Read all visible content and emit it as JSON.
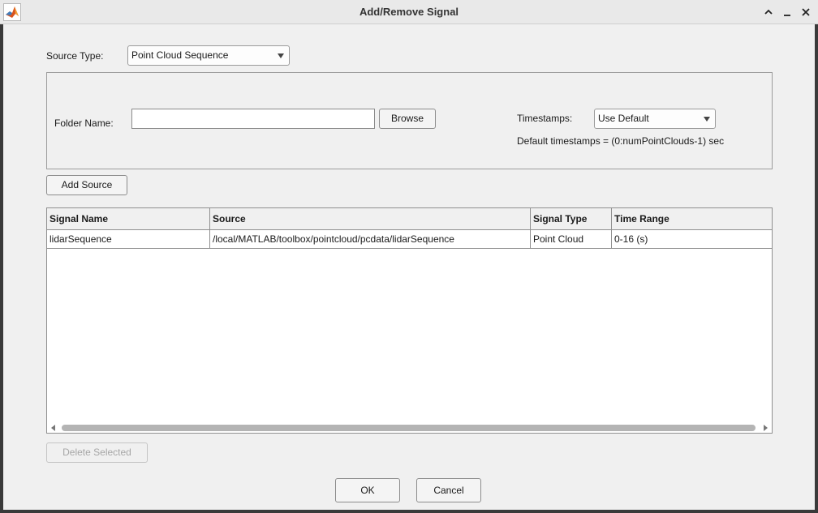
{
  "window": {
    "title": "Add/Remove Signal"
  },
  "source_type": {
    "label": "Source Type:",
    "selected": "Point Cloud Sequence"
  },
  "folder": {
    "label": "Folder Name:",
    "value": "",
    "browse_label": "Browse"
  },
  "timestamps": {
    "label": "Timestamps:",
    "selected": "Use Default",
    "note": "Default timestamps = (0:numPointClouds-1) sec"
  },
  "add_source_label": "Add Source",
  "table": {
    "columns": [
      "Signal Name",
      "Source",
      "Signal Type",
      "Time Range"
    ],
    "rows": [
      [
        "lidarSequence",
        "/local/MATLAB/toolbox/pointcloud/pcdata/lidarSequence",
        "Point Cloud",
        "0-16 (s)"
      ]
    ]
  },
  "delete_selected_label": "Delete Selected",
  "ok_label": "OK",
  "cancel_label": "Cancel",
  "icons": {
    "app": "matlab-logo-icon",
    "window_controls": [
      "maximize-icon",
      "minimize-icon",
      "close-icon"
    ],
    "scroll": [
      "scroll-left-icon",
      "scroll-right-icon"
    ]
  },
  "colors": {
    "background": "#f0f0f0",
    "titlebar": "#e9e9e9",
    "scroll_thumb": "#b4b4b4"
  }
}
